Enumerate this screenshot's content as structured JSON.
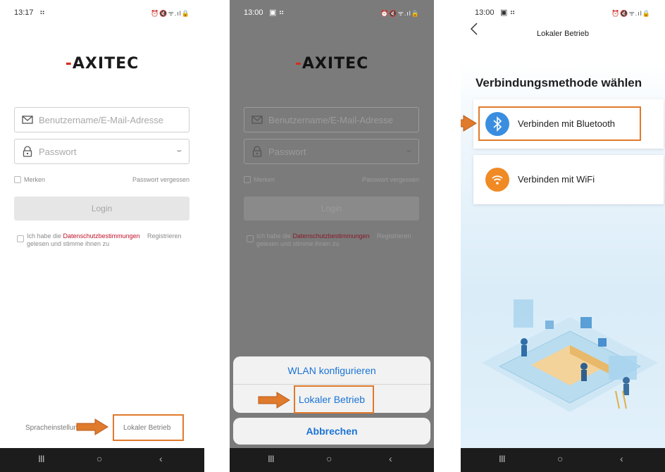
{
  "colors": {
    "accent_orange": "#e07a2c",
    "link_blue": "#1a73d6",
    "privacy_red": "#c0102a",
    "bluetooth_blue": "#3a8ee0",
    "wifi_orange": "#f08a24"
  },
  "phone1": {
    "status": {
      "time": "13:17",
      "dots": "⠶",
      "icons": "⏰🔇ᯤ.ıl🔒"
    },
    "logo": {
      "dash": "-",
      "text": "AXITEC"
    },
    "username_placeholder": "Benutzername/E-Mail-Adresse",
    "password_placeholder": "Passwort",
    "remember": "Merken",
    "forgot": "Passwort vergessen",
    "login": "Login",
    "consent_prefix": "Ich habe die ",
    "consent_link": "Datenschutzbestimmungen",
    "consent_suffix": "gelesen und stimme ihnen zu",
    "register": "Registrieren",
    "language": "Spracheinstellun",
    "local_mode": "Lokaler Betrieb"
  },
  "phone2": {
    "status": {
      "time": "13:00",
      "dots": "▣ ⠶",
      "icons": "⏰🔇ᯤ.ıl🔒"
    },
    "logo": {
      "dash": "-",
      "text": "AXITEC"
    },
    "username_placeholder": "Benutzername/E-Mail-Adresse",
    "password_placeholder": "Passwort",
    "remember": "Merken",
    "forgot": "Passwort vergessen",
    "login": "Login",
    "consent_prefix": "Ich habe die ",
    "consent_link": "Datenschutzbestimmungen",
    "consent_suffix": "gelesen und stimme ihnen zu",
    "register": "Registrieren",
    "sheet": {
      "wlan": "WLAN konfigurieren",
      "local": "Lokaler Betrieb",
      "cancel": "Abbrechen"
    }
  },
  "phone3": {
    "status": {
      "time": "13:00",
      "dots": "▣ ⠶",
      "icons": "⏰🔇ᯤ.ıl🔒"
    },
    "nav_title": "Lokaler Betrieb",
    "heading": "Verbindungsmethode wählen",
    "bluetooth": "Verbinden mit Bluetooth",
    "wifi": "Verbinden mit WiFi"
  },
  "navbar": {
    "recent": "III",
    "home": "○",
    "back": "‹"
  }
}
